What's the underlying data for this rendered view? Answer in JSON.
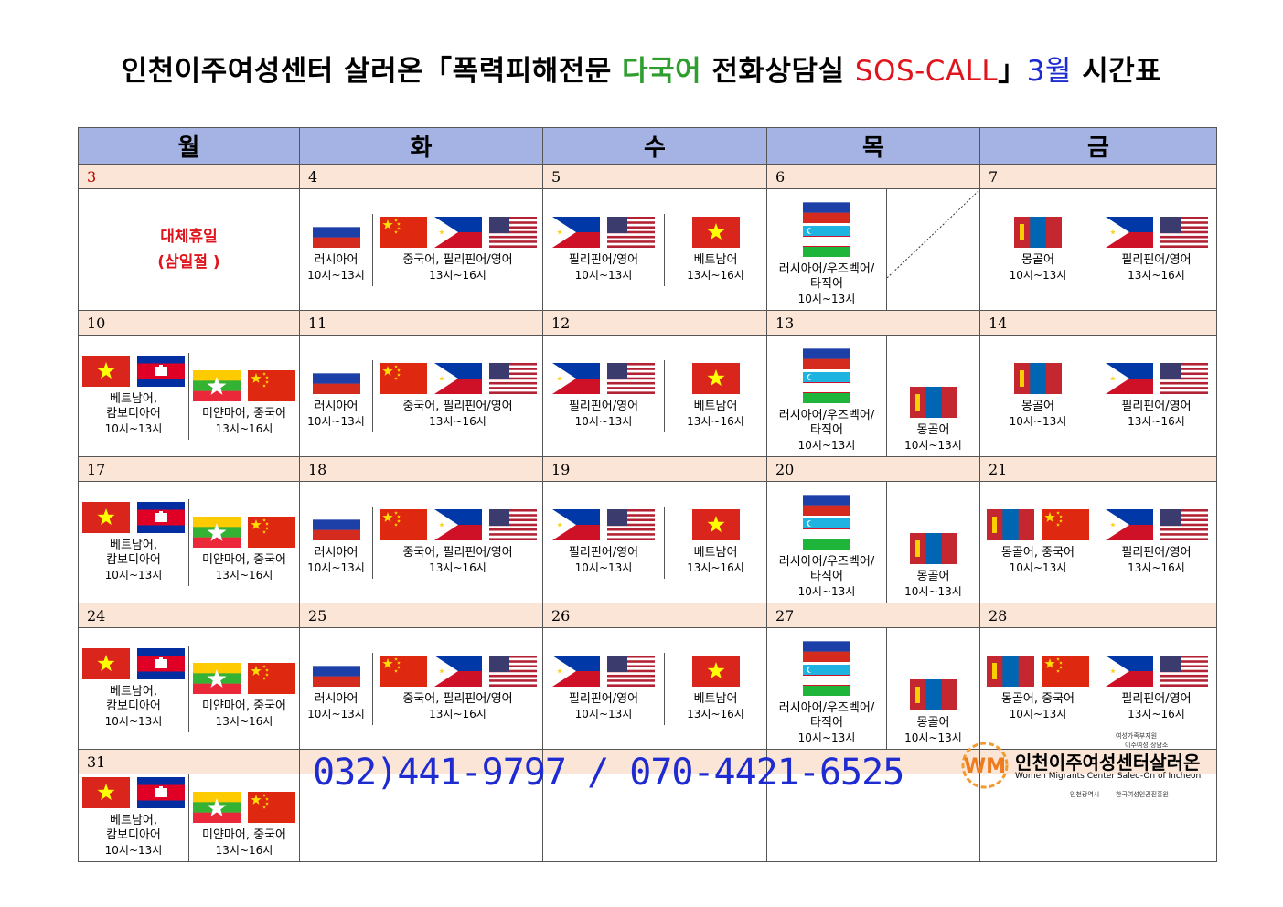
{
  "title": {
    "part1": "인천이주여성센터 살러온「폭력피해전문 ",
    "part2": "다국어",
    "part3": " 전화상담실 ",
    "part4": "SOS-CALL",
    "part5": "」",
    "part6": "3월",
    "part7": " 시간표"
  },
  "weekdays": [
    "월",
    "화",
    "수",
    "목",
    "금"
  ],
  "holiday": {
    "line1": "대체휴일",
    "line2": "(삼일절  )"
  },
  "slots": {
    "mon_am": {
      "lang": [
        "베트남어,",
        "캄보디아어"
      ],
      "time": "10시~13시"
    },
    "mon_pm": {
      "lang": [
        "미얀마어, 중국어"
      ],
      "time": "13시~16시"
    },
    "tue_am": {
      "lang": [
        "러시아어"
      ],
      "time": "10시~13시"
    },
    "tue_pm": {
      "lang": [
        "중국어, 필리핀어/영어"
      ],
      "time": "13시~16시"
    },
    "wed_am": {
      "lang": [
        "필리핀어/영어"
      ],
      "time": "10시~13시"
    },
    "wed_pm": {
      "lang": [
        "베트남어"
      ],
      "time": "13시~16시"
    },
    "thu_am": {
      "lang": [
        "러시아어/우즈벡어/",
        "타직어"
      ],
      "time": "10시~13시"
    },
    "thu_pm": {
      "lang": [
        "몽골어"
      ],
      "time": "10시~13시"
    },
    "fri_am1": {
      "lang": [
        "몽골어"
      ],
      "time": "10시~13시"
    },
    "fri_am2": {
      "lang": [
        "몽골어, 중국어"
      ],
      "time": "10시~13시"
    },
    "fri_pm": {
      "lang": [
        "필리핀어/영어"
      ],
      "time": "13시~16시"
    }
  },
  "weeks": [
    {
      "dates": [
        "3",
        "4",
        "5",
        "6",
        "7"
      ]
    },
    {
      "dates": [
        "10",
        "11",
        "12",
        "13",
        "14"
      ]
    },
    {
      "dates": [
        "17",
        "18",
        "19",
        "20",
        "21"
      ]
    },
    {
      "dates": [
        "24",
        "25",
        "26",
        "27",
        "28"
      ]
    },
    {
      "dates": [
        "31",
        "",
        "",
        "",
        ""
      ]
    }
  ],
  "phone": "032)441-9797 / 070-4421-6525",
  "logo": {
    "name": "인천이주여성센터살러온",
    "english": "Women Migrants Center Saleo-On of Incheon",
    "ministry": "여성가족부지원",
    "ministry2": "이주여성 상담소",
    "sponsor1": "인천광역시",
    "sponsor2": "한국여성인권진흥원"
  },
  "colors": {
    "header": "#a4b3e3",
    "date_row": "#fbe5d6",
    "holiday": "#e0141c",
    "phone": "#1d2bd1",
    "accent_green": "#2e9e2e"
  }
}
